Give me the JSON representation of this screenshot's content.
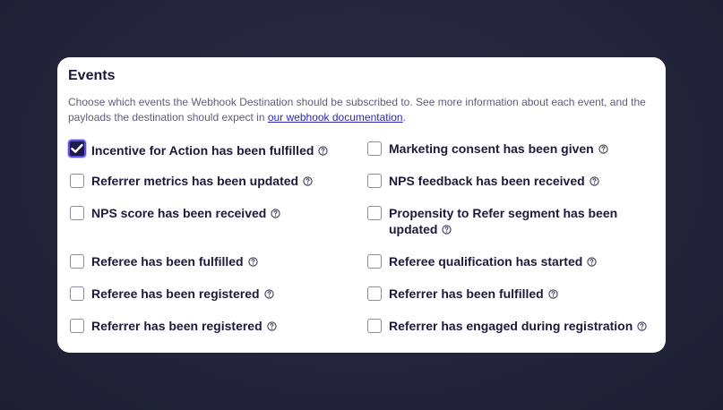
{
  "section": {
    "title": "Events",
    "description_prefix": "Choose which events the Webhook Destination should be subscribed to. See more information about each event, and the payloads the destination should expect in ",
    "doc_link_text": "our webhook documentation",
    "description_suffix": "."
  },
  "colors": {
    "accent": "#5b4fe3",
    "checked_fill": "#1e1b4b",
    "text": "#1b1a3a",
    "link": "#2c2ab5"
  },
  "events": [
    {
      "label": "Incentive for Action has been fulfilled",
      "checked": true,
      "icon": "help-circle-icon"
    },
    {
      "label": "Marketing consent has been given",
      "checked": false,
      "icon": "help-circle-icon"
    },
    {
      "label": "Referrer metrics has been updated",
      "checked": false,
      "icon": "help-circle-icon"
    },
    {
      "label": "NPS feedback has been received",
      "checked": false,
      "icon": "help-circle-icon"
    },
    {
      "label": "NPS score has been received",
      "checked": false,
      "icon": "help-circle-icon"
    },
    {
      "label": "Propensity to Refer segment has been updated",
      "checked": false,
      "icon": "help-circle-icon"
    },
    {
      "label": "Referee has been fulfilled",
      "checked": false,
      "icon": "help-circle-icon"
    },
    {
      "label": "Referee qualification has started",
      "checked": false,
      "icon": "help-circle-icon"
    },
    {
      "label": "Referee has been registered",
      "checked": false,
      "icon": "help-circle-icon"
    },
    {
      "label": "Referrer has been fulfilled",
      "checked": false,
      "icon": "help-circle-icon"
    },
    {
      "label": "Referrer has been registered",
      "checked": false,
      "icon": "help-circle-icon"
    },
    {
      "label": "Referrer has engaged during registration",
      "checked": false,
      "icon": "help-circle-icon"
    }
  ]
}
